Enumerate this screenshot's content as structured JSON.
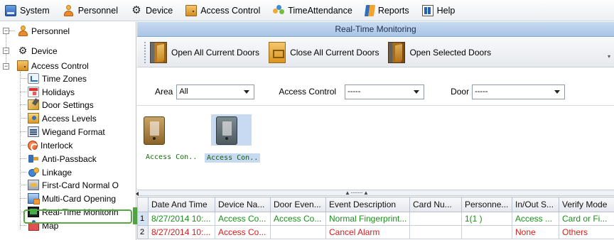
{
  "menu": [
    {
      "label": "System",
      "icon": "system-icon"
    },
    {
      "label": "Personnel",
      "icon": "personnel-icon"
    },
    {
      "label": "Device",
      "icon": "gear-icon"
    },
    {
      "label": "Access Control",
      "icon": "access-control-icon"
    },
    {
      "label": "TimeAttendance",
      "icon": "time-attendance-icon"
    },
    {
      "label": "Reports",
      "icon": "reports-icon"
    },
    {
      "label": "Help",
      "icon": "help-icon"
    }
  ],
  "tree": {
    "personnel": "Personnel",
    "device": "Device",
    "access_control": "Access Control",
    "children": [
      {
        "label": "Time Zones",
        "icon": "time-zones-icon"
      },
      {
        "label": "Holidays",
        "icon": "holidays-icon"
      },
      {
        "label": "Door Settings",
        "icon": "door-settings-icon"
      },
      {
        "label": "Access Levels",
        "icon": "access-levels-icon"
      },
      {
        "label": "Wiegand Format",
        "icon": "wiegand-format-icon"
      },
      {
        "label": "Interlock",
        "icon": "interlock-icon"
      },
      {
        "label": "Anti-Passback",
        "icon": "anti-passback-icon"
      },
      {
        "label": "Linkage",
        "icon": "linkage-icon"
      },
      {
        "label": "First-Card Normal O",
        "icon": "first-card-icon"
      },
      {
        "label": "Multi-Card Opening",
        "icon": "multi-card-icon"
      },
      {
        "label": "Real-Time Monitorin",
        "icon": "real-time-monitoring-icon"
      },
      {
        "label": "Map",
        "icon": "map-icon"
      }
    ],
    "step_badge": "1"
  },
  "main": {
    "title": "Real-Time Monitoring",
    "toolbar": {
      "open_all": "Open All Current Doors",
      "close_all": "Close All Current Doors",
      "open_selected": "Open Selected Doors"
    },
    "filters": {
      "area_label": "Area",
      "area_value": "All",
      "ac_label": "Access Control",
      "ac_value": "-----",
      "door_label": "Door",
      "door_value": "-----"
    },
    "doors": [
      {
        "label": "Access Con..",
        "state": "normal"
      },
      {
        "label": "Access Con..",
        "state": "selected"
      }
    ],
    "grid": {
      "columns": [
        "Date And Time",
        "Device Na...",
        "Door Even...",
        "Event Description",
        "Card Nu...",
        "Personne...",
        "In/Out S...",
        "Verify Mode"
      ],
      "rows": [
        {
          "num": "1",
          "cells": [
            "8/27/2014 10:...",
            "Access Co...",
            "Access Co...",
            "Normal Fingerprint...",
            "",
            "1(1 )",
            "Access ...",
            "Card or Fi..."
          ],
          "status": "normal"
        },
        {
          "num": "2",
          "cells": [
            "8/27/2014 10:...",
            "Access Co...",
            "",
            "Cancel Alarm",
            "",
            "",
            "None",
            "Others"
          ],
          "status": "alarm"
        }
      ]
    }
  },
  "colors": {
    "title_bar": "#b4cdea",
    "highlight": "#57a845",
    "normal_event": "#1d8e1d",
    "alarm_event": "#d02020"
  }
}
